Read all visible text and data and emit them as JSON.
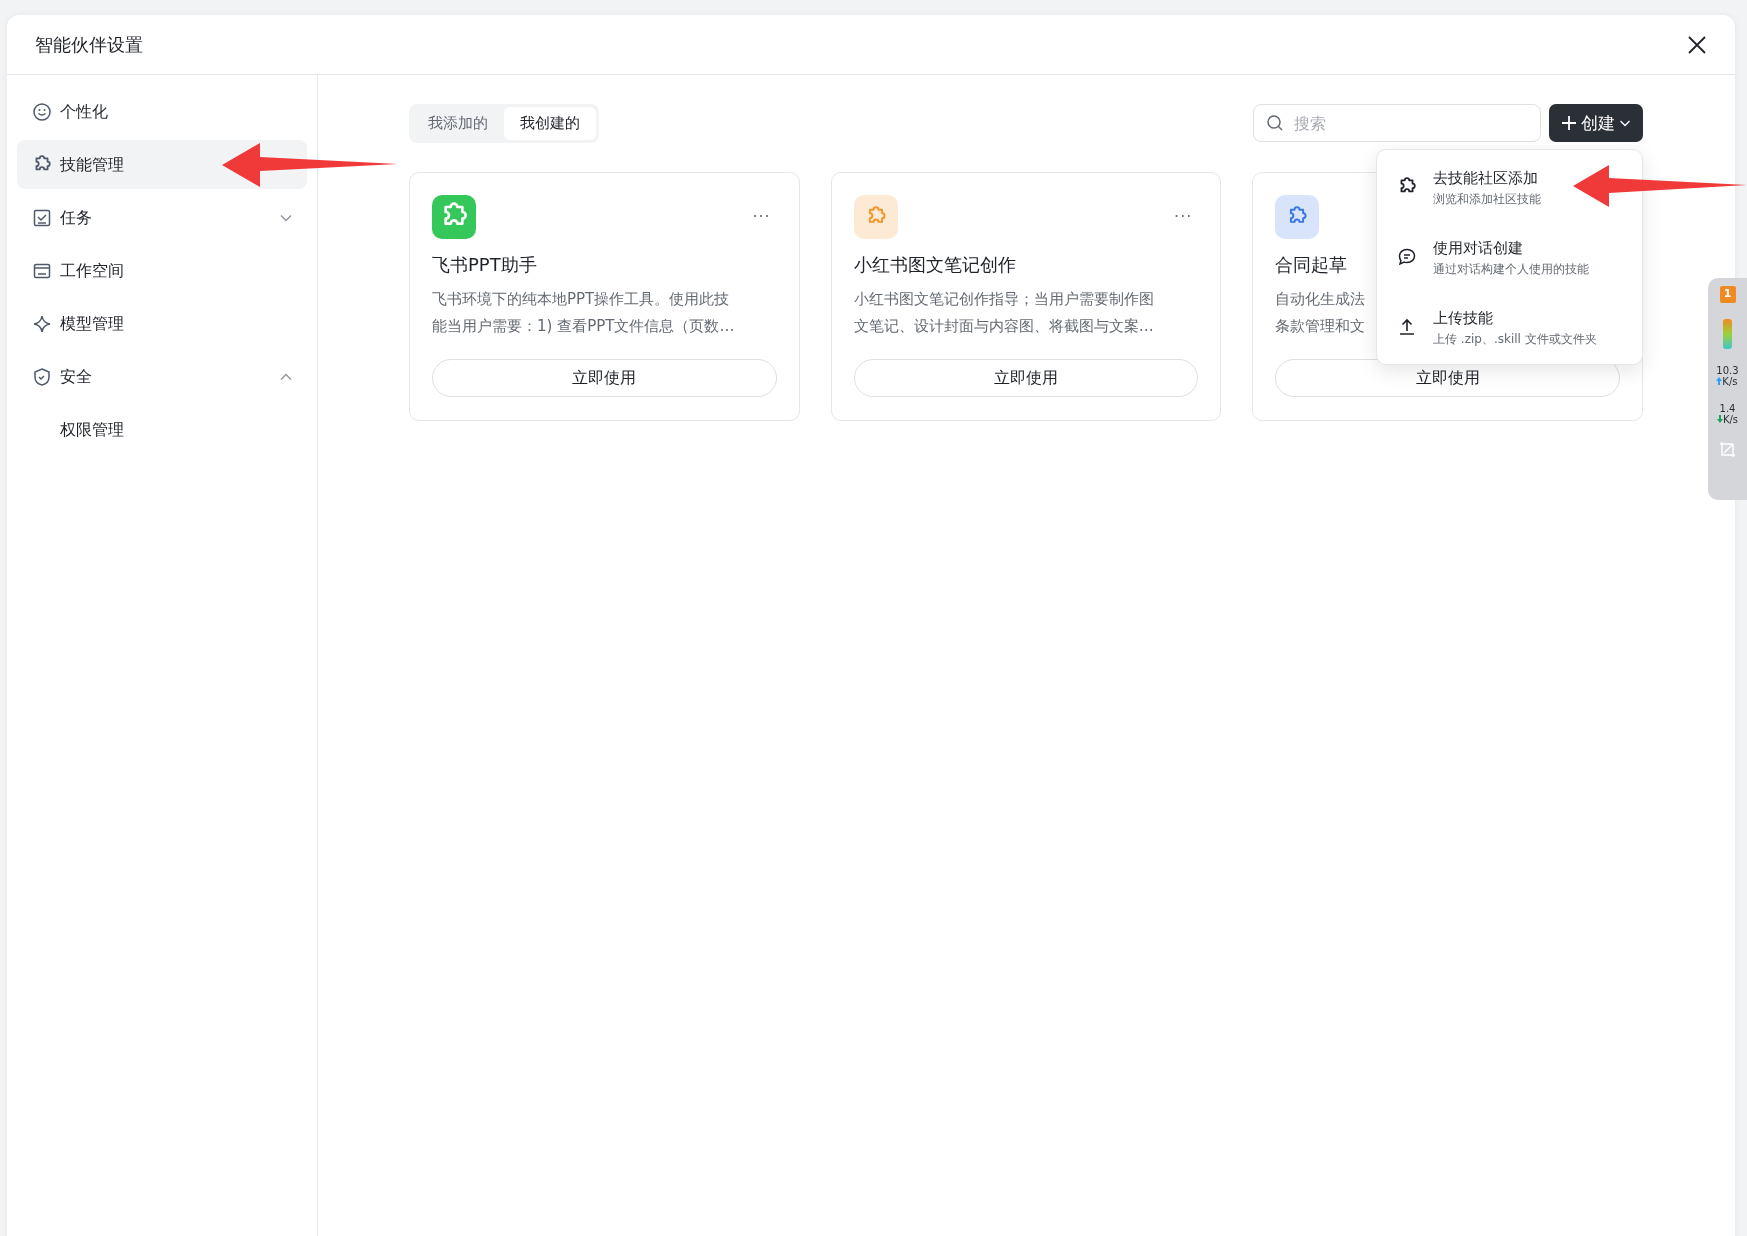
{
  "window": {
    "title": "智能伙伴设置"
  },
  "sidebar": {
    "items": [
      {
        "label": "个性化",
        "selected": false
      },
      {
        "label": "技能管理",
        "selected": true
      },
      {
        "label": "任务",
        "selected": false,
        "expanded": false
      },
      {
        "label": "工作空间",
        "selected": false
      },
      {
        "label": "模型管理",
        "selected": false
      },
      {
        "label": "安全",
        "selected": false,
        "expanded": true,
        "children": [
          {
            "label": "权限管理",
            "selected": false
          }
        ]
      }
    ]
  },
  "tabs": [
    {
      "label": "我添加的",
      "selected": false
    },
    {
      "label": "我创建的",
      "selected": true
    }
  ],
  "search": {
    "placeholder": "搜索"
  },
  "create_button": {
    "label": "创建"
  },
  "create_menu": [
    {
      "title": "去技能社区添加",
      "subtitle": "浏览和添加社区技能"
    },
    {
      "title": "使用对话创建",
      "subtitle": "通过对话构建个人使用的技能"
    },
    {
      "title": "上传技能",
      "subtitle": "上传 .zip、.skill 文件或文件夹"
    }
  ],
  "cards": [
    {
      "title": "飞书PPT助手",
      "kind": "solid",
      "color": "#34c759",
      "desc_lines": [
        "飞书环境下的纯本地PPT操作工具。使用此技",
        "能当用户需要：1) 查看PPT文件信息（页数…"
      ],
      "button": "立即使用",
      "menu": "···"
    },
    {
      "title": "小红书图文笔记创作",
      "kind": "tint",
      "color": "#f0962a",
      "desc_lines": [
        "小红书图文笔记创作指导；当用户需要制作图",
        "文笔记、设计封面与内容图、将截图与文案…"
      ],
      "button": "立即使用",
      "menu": "···"
    },
    {
      "title": "合同起草",
      "kind": "tint",
      "color": "#3a78e0",
      "desc_lines": [
        "自动化生成法",
        "条款管理和文"
      ],
      "button": "立即使用"
    }
  ],
  "speed_widget": {
    "badge": "1",
    "upload": {
      "value": "10.3",
      "unit": "K/s"
    },
    "download": {
      "value": "1.4",
      "unit": "K/s"
    }
  }
}
